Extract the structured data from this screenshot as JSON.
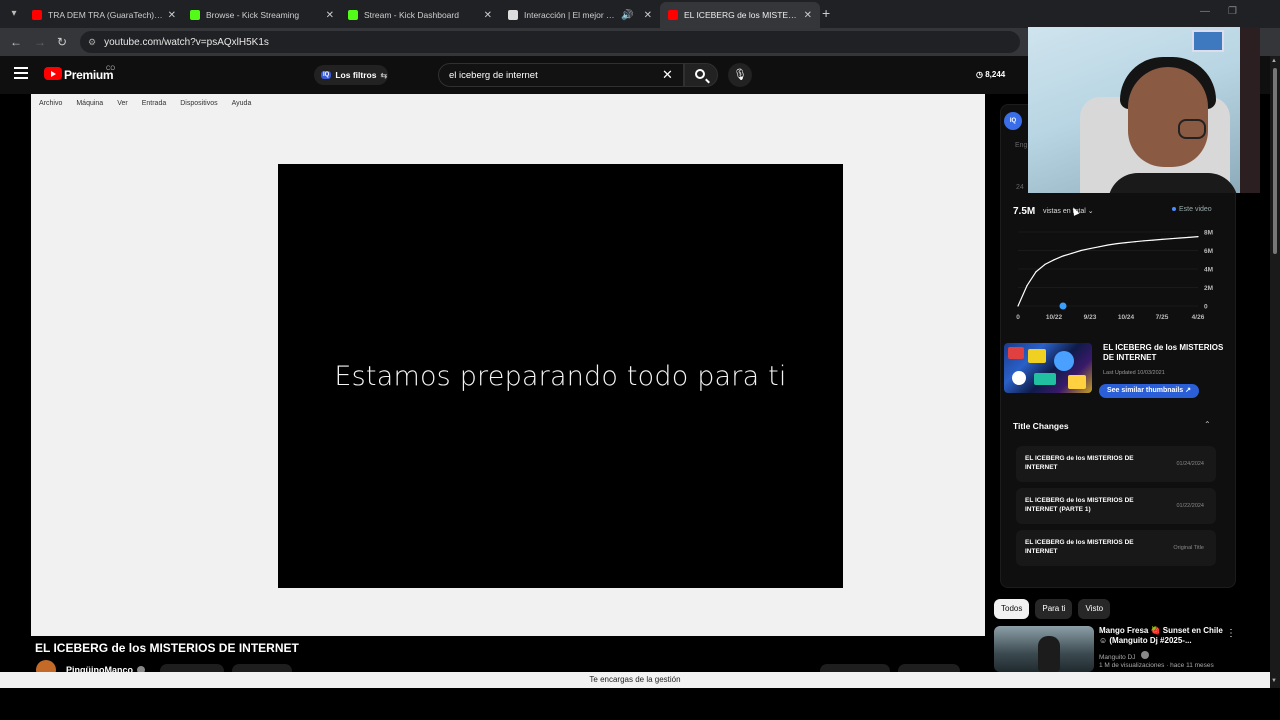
{
  "browser": {
    "tabs": [
      {
        "title": "TRA DEM TRA (GuaraTech) - Yo",
        "color": "#ff0000"
      },
      {
        "title": "Browse - Kick Streaming",
        "color": "#53fc18"
      },
      {
        "title": "Stream - Kick Dashboard",
        "color": "#53fc18"
      },
      {
        "title": "Interacción | El mejor softwa",
        "color": "#dddddd"
      },
      {
        "title": "EL ICEBERG de los MISTERIOS D",
        "color": "#ff0000"
      }
    ],
    "url": "youtube.com/watch?v=psAQxlH5K1s"
  },
  "yt": {
    "brand": "Premium",
    "country": "CO",
    "filters_label": "Los filtros",
    "search_value": "el iceberg de internet",
    "view_stat": "8,244"
  },
  "vm": {
    "menu": [
      "Archivo",
      "Máquina",
      "Ver",
      "Entrada",
      "Dispositivos",
      "Ayuda"
    ],
    "screen_text": "Estamos preparando todo para ti"
  },
  "video": {
    "title": "EL ICEBERG de los MISTERIOS DE INTERNET",
    "channel": "PingüinoManco"
  },
  "status_bar": "Te encargas de la gestión",
  "panel": {
    "iq": "IQ",
    "eng": "Eng",
    "day": "24",
    "total": "7.5M",
    "dropdown": "vistas en total",
    "this_video": "Este video",
    "thumb_title": "EL ICEBERG de los MISTERIOS DE INTERNET",
    "last_updated": "Last Updated 10/03/2021",
    "similar": "See similar thumbnails",
    "title_changes_header": "Title Changes",
    "title_changes": [
      {
        "title": "EL ICEBERG de los MISTERIOS DE INTERNET",
        "date": "01/24/2024"
      },
      {
        "title": "EL ICEBERG de los MISTERIOS DE INTERNET (PARTE 1)",
        "date": "01/22/2024"
      },
      {
        "title": "EL ICEBERG de los MISTERIOS DE INTERNET",
        "date": "Original Title"
      }
    ]
  },
  "chart_data": {
    "type": "line",
    "x": [
      0,
      1,
      2,
      3,
      4,
      5,
      6,
      7,
      8,
      9,
      10,
      11,
      12,
      13,
      14,
      15,
      16,
      17,
      18,
      19,
      20
    ],
    "y": [
      0,
      2.2,
      3.7,
      4.5,
      5.0,
      5.4,
      5.7,
      6.0,
      6.2,
      6.4,
      6.6,
      6.75,
      6.85,
      6.95,
      7.05,
      7.12,
      7.2,
      7.28,
      7.35,
      7.42,
      7.5
    ],
    "xticks": [
      "0",
      "10/22",
      "9/23",
      "10/24",
      "7/25",
      "4/26"
    ],
    "yticks": [
      "8M",
      "6M",
      "4M",
      "2M",
      "0"
    ],
    "ylim": [
      0,
      8
    ],
    "marker_index": 5,
    "line_color": "#ffffff",
    "marker_color": "#3aa0ff"
  },
  "chips": [
    "Todos",
    "Para ti",
    "Visto"
  ],
  "recommendation": {
    "title": "Mango  Fresa 🍓 Sunset en Chile ☺ (Manguito Dj #2025-...",
    "channel": "Manguito DJ",
    "meta": "1 M de visualizaciones · hace 11 meses"
  }
}
